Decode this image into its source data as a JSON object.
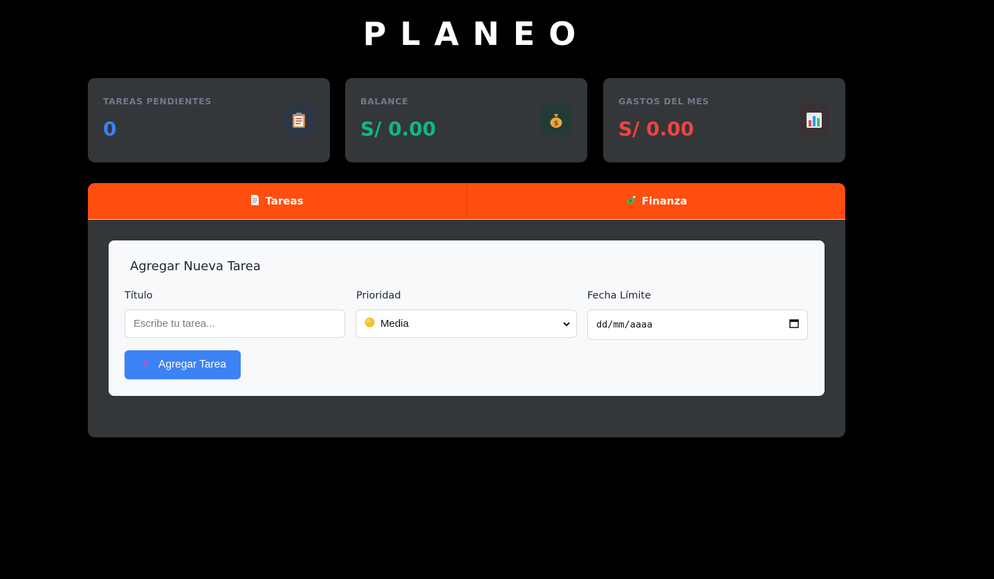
{
  "app": {
    "title": "PLANEO"
  },
  "stats": [
    {
      "label": "TAREAS PENDIENTES",
      "value": "0",
      "color": "#3b82f6",
      "icon": "clipboard-icon",
      "icon_bg": "#2c3644"
    },
    {
      "label": "BALANCE",
      "value": "S/ 0.00",
      "color": "#10b981",
      "icon": "money-bag-icon",
      "icon_bg": "#243b35"
    },
    {
      "label": "GASTOS DEL MES",
      "value": "S/ 0.00",
      "color": "#ef4444",
      "icon": "bar-chart-icon",
      "icon_bg": "#3b3033"
    }
  ],
  "tabs": [
    {
      "label": "Tareas",
      "icon": "document-icon"
    },
    {
      "label": "Finanza",
      "icon": "money-wings-icon"
    }
  ],
  "form": {
    "title": "Agregar Nueva Tarea",
    "title_field": {
      "label": "Título",
      "placeholder": "Escribe tu tarea...",
      "value": ""
    },
    "priority_field": {
      "label": "Prioridad",
      "value": "Media",
      "icon": "yellow-circle-icon"
    },
    "date_field": {
      "label": "Fecha Límite",
      "placeholder": "dd/mm/aaaa",
      "icon": "calendar-icon"
    },
    "submit_label": "Agregar Tarea",
    "submit_icon": "sparkle-icon"
  },
  "colors": {
    "accent_orange": "#ff4e0f",
    "primary_blue": "#3b82f6",
    "card_bg": "#33373a"
  }
}
